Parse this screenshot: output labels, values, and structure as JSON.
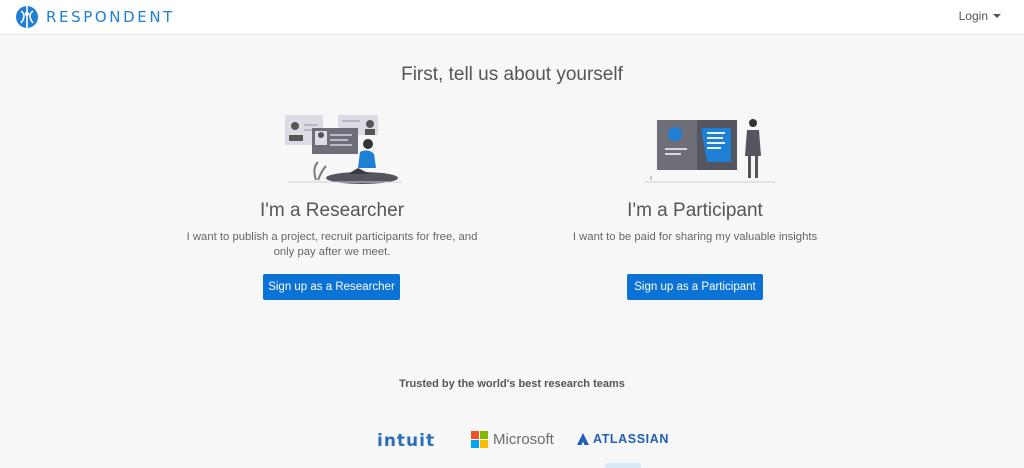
{
  "header": {
    "brand_name": "RESPONDENT",
    "logo_icon": "respondent-logo",
    "login_label": "Login",
    "accent": "#1f7fd4"
  },
  "main": {
    "headline": "First, tell us about yourself",
    "researcher": {
      "title": "I'm a Researcher",
      "description": "I want to publish a project, recruit participants for free, and only pay after we meet.",
      "button_label": "Sign up as a Researcher"
    },
    "participant": {
      "title": "I'm a Participant",
      "description": "I want to be paid for sharing my valuable insights",
      "button_label": "Sign up as a Participant"
    },
    "button_color": "#0b72d6"
  },
  "trusted": {
    "heading": "Trusted by the world's best research teams",
    "logos": {
      "intuit": "intuit",
      "microsoft": "Microsoft",
      "atlassian": "ATLASSIAN"
    }
  }
}
